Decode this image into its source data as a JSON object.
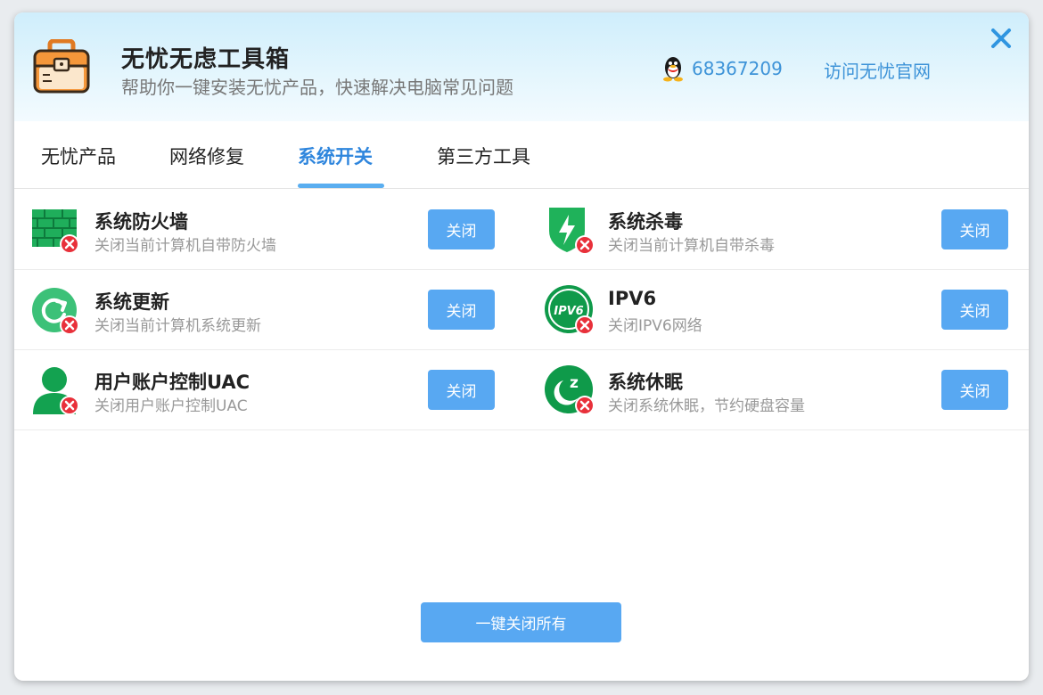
{
  "header": {
    "title": "无忧无虑工具箱",
    "subtitle": "帮助你一键安装无忧产品，快速解决电脑常见问题",
    "qq_number": "68367209",
    "official_link": "访问无忧官网"
  },
  "tabs": [
    {
      "label": "无忧产品",
      "active": false
    },
    {
      "label": "网络修复",
      "active": false
    },
    {
      "label": "系统开关",
      "active": true
    },
    {
      "label": "第三方工具",
      "active": false
    }
  ],
  "items": [
    {
      "title": "系统防火墙",
      "desc": "关闭当前计算机自带防火墙",
      "button": "关闭",
      "icon": "firewall-icon"
    },
    {
      "title": "系统杀毒",
      "desc": "关闭当前计算机自带杀毒",
      "button": "关闭",
      "icon": "antivirus-shield-icon"
    },
    {
      "title": "系统更新",
      "desc": "关闭当前计算机系统更新",
      "button": "关闭",
      "icon": "update-icon"
    },
    {
      "title": "IPV6",
      "desc": "关闭IPV6网络",
      "button": "关闭",
      "icon": "ipv6-icon"
    },
    {
      "title": "用户账户控制UAC",
      "desc": "关闭用户账户控制UAC",
      "button": "关闭",
      "icon": "user-uac-icon"
    },
    {
      "title": "系统休眠",
      "desc": "关闭系统休眠，节约硬盘容量",
      "button": "关闭",
      "icon": "sleep-icon"
    }
  ],
  "footer": {
    "close_all_label": "一键关闭所有"
  },
  "colors": {
    "accent": "#2f86dd",
    "button": "#58a8f2",
    "icon_green": "#1fb25a",
    "badge_red": "#e8303a"
  }
}
